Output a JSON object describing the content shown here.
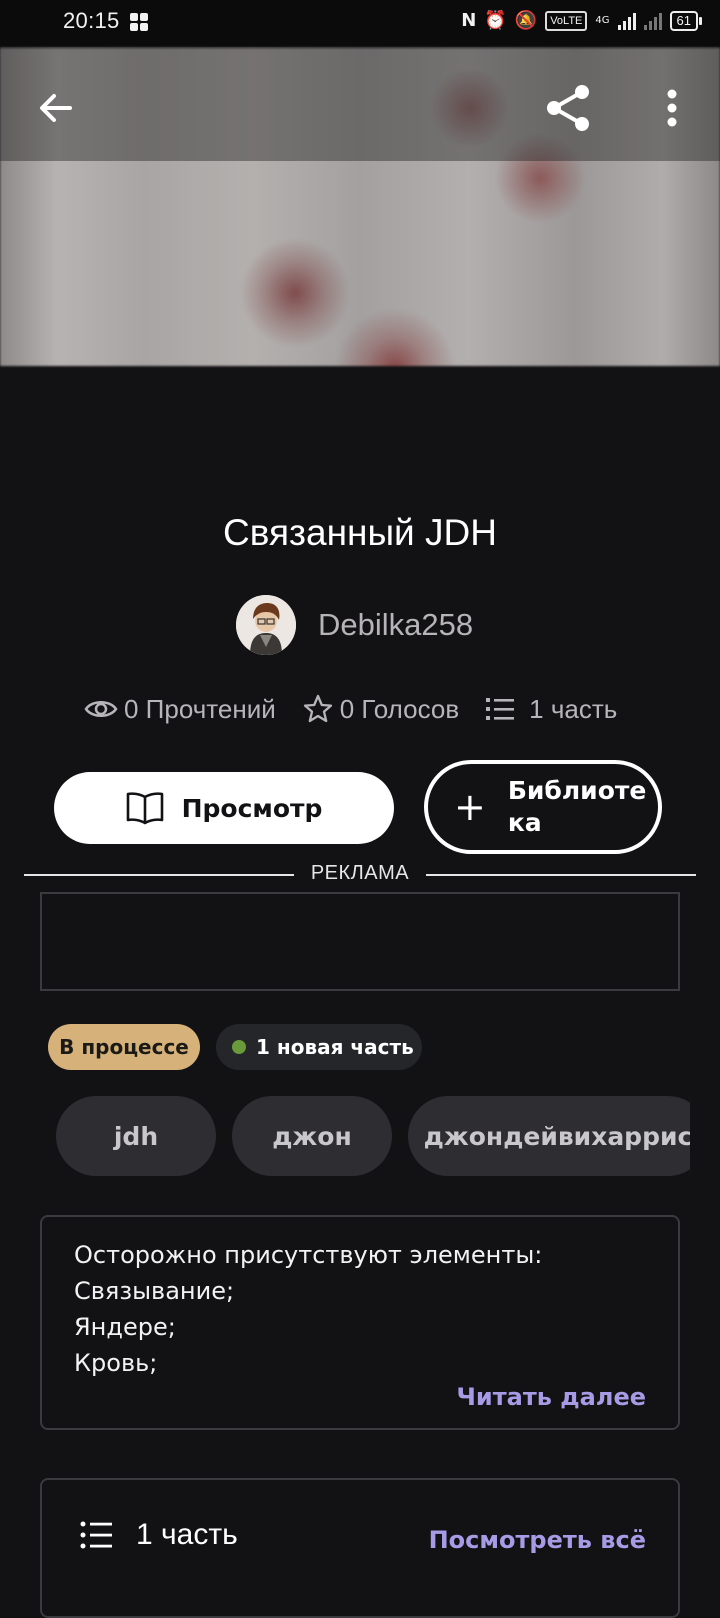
{
  "status_bar": {
    "time": "20:15",
    "battery": "61",
    "network": "4G",
    "volte": "VoLTE"
  },
  "story": {
    "title": "Связанный JDH",
    "author": "Debilka258",
    "stats": {
      "reads": "0 Прочтений",
      "votes": "0 Голосов",
      "parts": "1 часть"
    }
  },
  "actions": {
    "view_label": "Просмотр",
    "library_label": "Библиотека",
    "library_label_line1": "Библиоте",
    "library_label_line2": "ка"
  },
  "ad": {
    "label": "РЕКЛАМА"
  },
  "badges": {
    "status": "В процессе",
    "new_parts": "1 новая часть"
  },
  "tags": [
    "jdh",
    "джон",
    "джондейвихаррис"
  ],
  "description": {
    "lines": [
      "Осторожно присутствуют элементы:",
      "Связывание;",
      "Яндере;",
      "Кровь;"
    ],
    "read_more": "Читать далее"
  },
  "parts_section": {
    "title": "1 часть",
    "view_all": "Посмотреть всё"
  },
  "colors": {
    "background": "#121114",
    "accent": "#a79be6",
    "status_badge": "#d6b27a",
    "new_dot": "#6a9a3a"
  },
  "icons": [
    "back-arrow-icon",
    "share-icon",
    "more-vertical-icon",
    "eye-icon",
    "star-icon",
    "list-icon",
    "book-icon",
    "plus-icon"
  ]
}
